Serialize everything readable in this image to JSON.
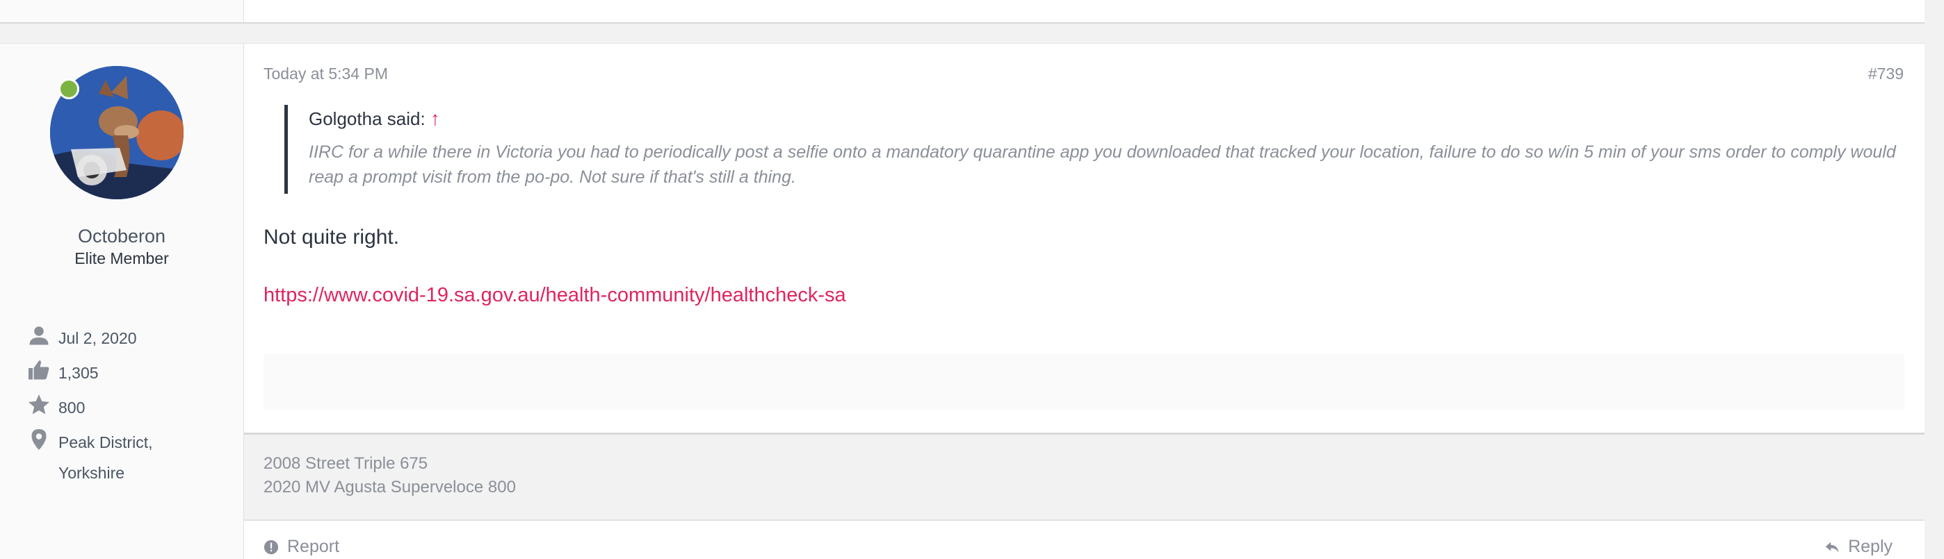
{
  "post": {
    "date": "Today at 5:34 PM",
    "number": "#739",
    "quote": {
      "author_said": "Golgotha said:",
      "arrow": "↑",
      "text": "IIRC for a while there in Victoria you had to periodically post a selfie onto a mandatory quarantine app you downloaded that tracked your location, failure to do so w/in 5 min of your sms order to comply would reap a prompt visit from the po-po. Not sure if that's still a thing."
    },
    "body_text": "Not quite right.",
    "link": "https://www.covid-19.sa.gov.au/health-community/healthcheck-sa",
    "signature": [
      "2008 Street Triple 675",
      "2020 MV Agusta Superveloce 800"
    ],
    "actions": {
      "report": "Report",
      "reply": "Reply"
    }
  },
  "user": {
    "name": "Octoberon",
    "title": "Elite Member",
    "online": true,
    "stats": [
      {
        "icon": "user-icon",
        "value": "Jul 2, 2020"
      },
      {
        "icon": "thumbs-up-icon",
        "value": "1,305"
      },
      {
        "icon": "star-icon",
        "value": "800"
      },
      {
        "icon": "location-pin-icon",
        "value": "Peak District,"
      },
      {
        "icon": "",
        "value": "Yorkshire"
      }
    ]
  },
  "colors": {
    "accent": "#e0245e",
    "online": "#7cb342",
    "muted": "#8a8f98"
  }
}
